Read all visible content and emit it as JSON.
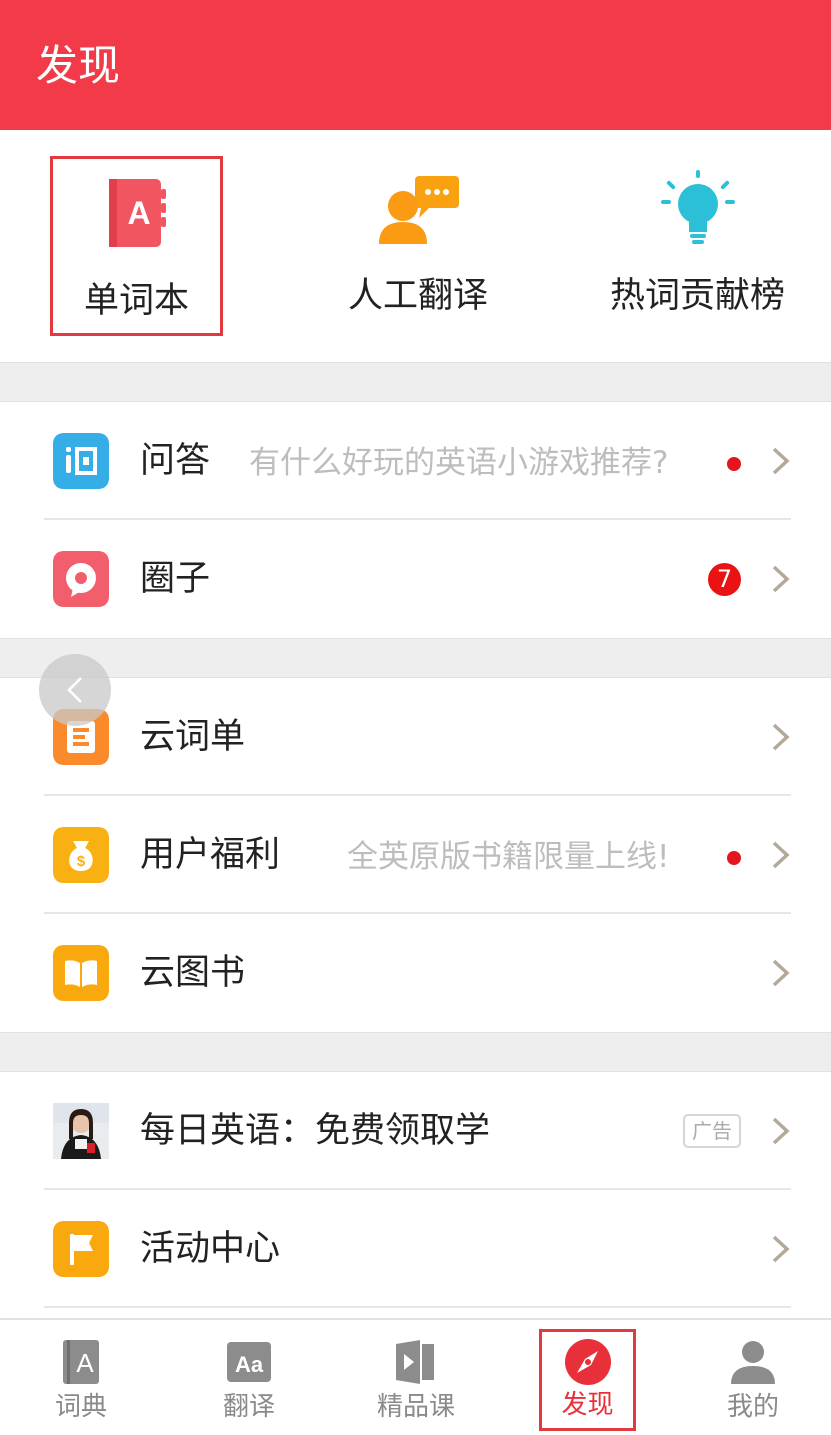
{
  "header": {
    "title": "发现"
  },
  "quick_actions": [
    {
      "label": "单词本",
      "icon": "wordbook-icon"
    },
    {
      "label": "人工翻译",
      "icon": "human-translation-icon"
    },
    {
      "label": "热词贡献榜",
      "icon": "lightbulb-icon"
    }
  ],
  "section1": [
    {
      "label": "问答",
      "sub": "有什么好玩的英语小游戏推荐?",
      "icon": "qa-icon",
      "color": "#35aee8"
    },
    {
      "label": "圈子",
      "badge": "7",
      "icon": "circle-chat-icon",
      "color": "#f25e6b"
    }
  ],
  "section2": [
    {
      "label": "云词单",
      "icon": "wordlist-icon",
      "color": "#fb8a2a"
    },
    {
      "label": "用户福利",
      "sub": "全英原版书籍限量上线!",
      "icon": "welfare-icon",
      "color": "#f9b012"
    },
    {
      "label": "云图书",
      "icon": "book-icon",
      "color": "#f9a90e"
    }
  ],
  "section3": [
    {
      "label": "每日英语：免费领取学",
      "ad": "广告",
      "icon": "ad-avatar"
    },
    {
      "label": "活动中心",
      "icon": "flag-icon",
      "color": "#f9a90e"
    }
  ],
  "tabs": [
    {
      "label": "词典",
      "icon": "dictionary-icon"
    },
    {
      "label": "翻译",
      "icon": "translate-icon"
    },
    {
      "label": "精品课",
      "icon": "course-icon"
    },
    {
      "label": "发现",
      "icon": "compass-icon",
      "active": true
    },
    {
      "label": "我的",
      "icon": "profile-icon"
    }
  ],
  "colors": {
    "brand": "#f23a48",
    "accent": "#e8303b"
  }
}
